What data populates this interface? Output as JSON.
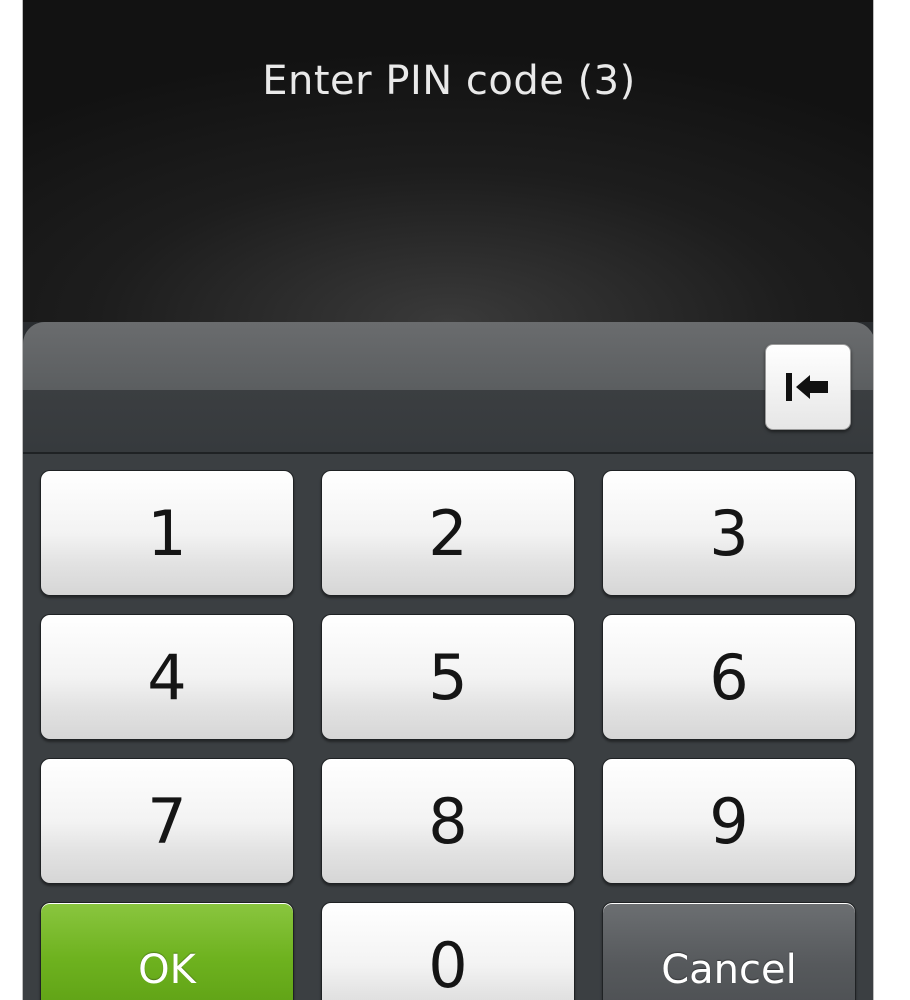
{
  "prompt": "Enter PIN code (3)",
  "pin_field": {
    "value": ""
  },
  "backspace": {
    "icon": "backspace-icon"
  },
  "keys": {
    "k1": "1",
    "k2": "2",
    "k3": "3",
    "k4": "4",
    "k5": "5",
    "k6": "6",
    "k7": "7",
    "k8": "8",
    "k9": "9",
    "ok": "OK",
    "k0": "0",
    "cancel": "Cancel"
  },
  "colors": {
    "ok_green": "#6eb21f",
    "cancel_gray": "#56595c",
    "header_bg": "#1d1d1d"
  }
}
